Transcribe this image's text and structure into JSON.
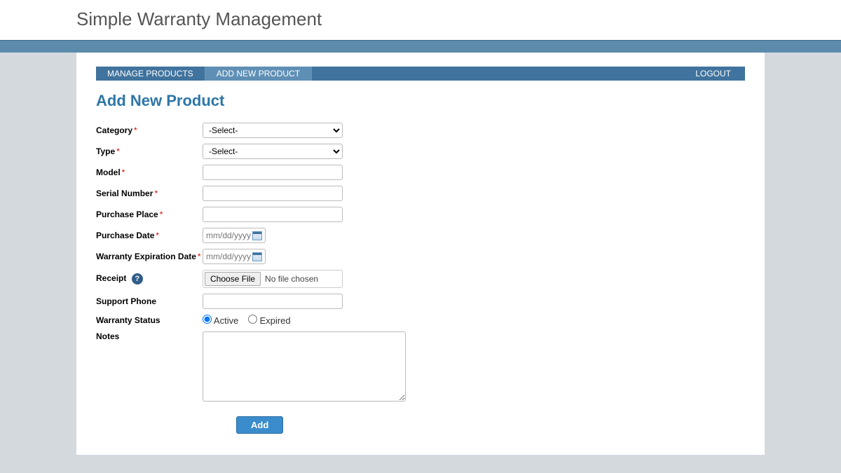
{
  "app_title": "Simple Warranty Management",
  "nav": {
    "tabs": [
      {
        "label": "MANAGE PRODUCTS",
        "active": false
      },
      {
        "label": "ADD NEW PRODUCT",
        "active": true
      }
    ],
    "logout": "LOGOUT"
  },
  "page_title": "Add New Product",
  "form": {
    "category": {
      "label": "Category",
      "required": true,
      "placeholder": "-Select-"
    },
    "type": {
      "label": "Type",
      "required": true,
      "placeholder": "-Select-"
    },
    "model": {
      "label": "Model",
      "required": true,
      "value": ""
    },
    "serial_number": {
      "label": "Serial Number",
      "required": true,
      "value": ""
    },
    "purchase_place": {
      "label": "Purchase Place",
      "required": true,
      "value": ""
    },
    "purchase_date": {
      "label": "Purchase Date",
      "required": true,
      "placeholder": "mm/dd/yyyy"
    },
    "warranty_exp": {
      "label": "Warranty Expiration Date",
      "required": true,
      "placeholder": "mm/dd/yyyy"
    },
    "receipt": {
      "label": "Receipt",
      "help": "?",
      "choose_label": "Choose File",
      "no_file": "No file chosen"
    },
    "support_phone": {
      "label": "Support Phone",
      "value": ""
    },
    "warranty_status": {
      "label": "Warranty Status",
      "options": {
        "active": "Active",
        "expired": "Expired"
      },
      "selected": "active"
    },
    "notes": {
      "label": "Notes",
      "value": ""
    }
  },
  "submit_label": "Add",
  "required_marker": "*"
}
